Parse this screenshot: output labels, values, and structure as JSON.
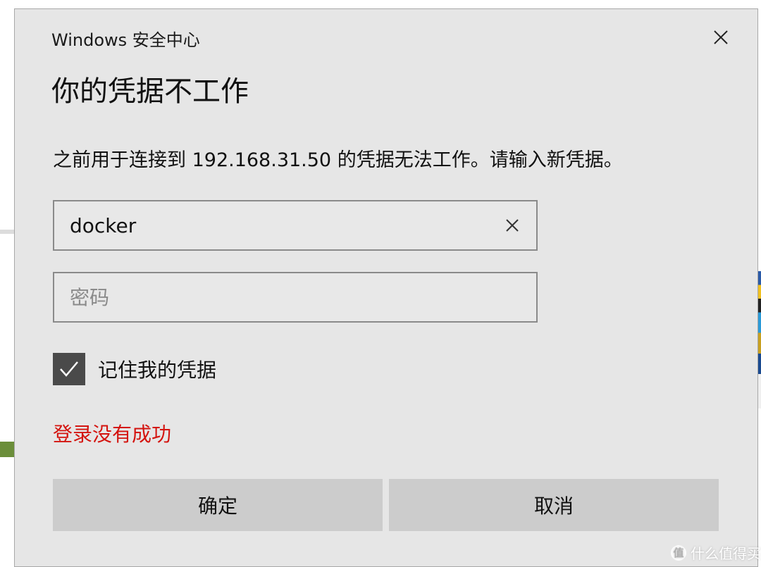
{
  "dialog": {
    "app_title": "Windows 安全中心",
    "heading": "你的凭据不工作",
    "message": "之前用于连接到 192.168.31.50 的凭据无法工作。请输入新凭据。",
    "username": {
      "value": "docker"
    },
    "password": {
      "placeholder": "密码",
      "value": ""
    },
    "remember": {
      "label": "记住我的凭据",
      "checked": true
    },
    "error_text": "登录没有成功",
    "ok_label": "确定",
    "cancel_label": "取消",
    "close_icon": "close-icon"
  },
  "watermark": {
    "logo_text": "值",
    "text": "什么值得买"
  },
  "colors": {
    "dialog_bg": "#e6e6e6",
    "error": "#d4140f",
    "button_bg": "#cccccc",
    "checkbox_bg": "#4a4a4a"
  }
}
